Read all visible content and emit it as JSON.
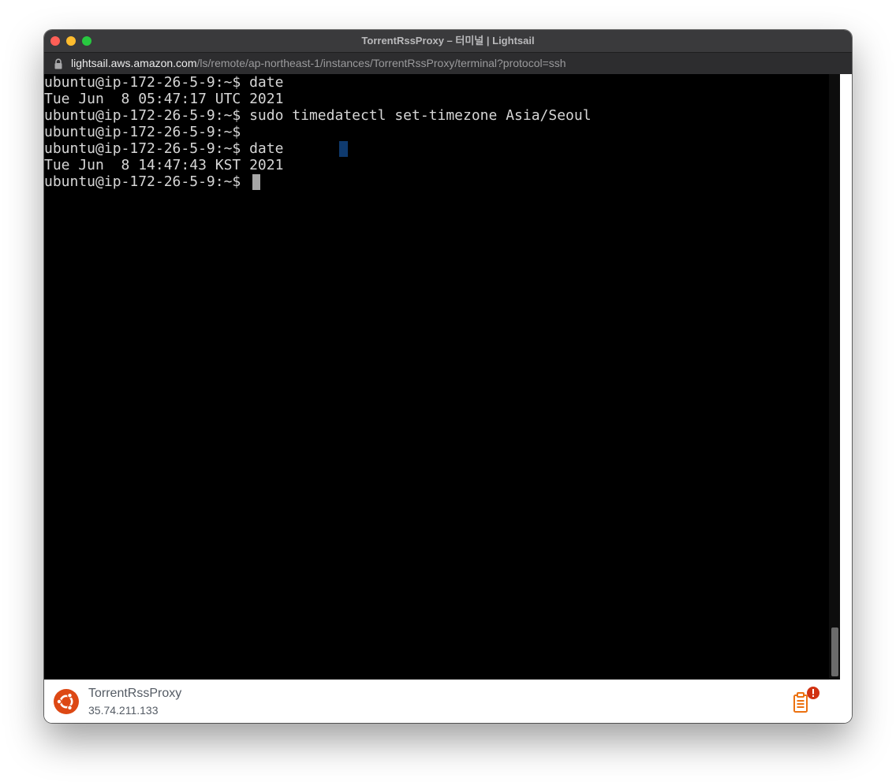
{
  "window": {
    "title": "TorrentRssProxy – 터미널 | Lightsail"
  },
  "address_bar": {
    "host": "lightsail.aws.amazon.com",
    "path": "/ls/remote/ap-northeast-1/instances/TorrentRssProxy/terminal?protocol=ssh"
  },
  "terminal": {
    "lines": [
      "ubuntu@ip-172-26-5-9:~$ date",
      "Tue Jun  8 05:47:17 UTC 2021",
      "ubuntu@ip-172-26-5-9:~$ sudo timedatectl set-timezone Asia/Seoul",
      "ubuntu@ip-172-26-5-9:~$",
      "ubuntu@ip-172-26-5-9:~$ date",
      "Tue Jun  8 14:47:43 KST 2021",
      "ubuntu@ip-172-26-5-9:~$"
    ]
  },
  "footer": {
    "instance_name": "TorrentRssProxy",
    "instance_ip": "35.74.211.133",
    "os_icon": "ubuntu-logo-icon",
    "log_icon": "clipboard-alert-icon"
  },
  "colors": {
    "terminal_bg": "#000000",
    "terminal_fg": "#d6d6d6",
    "titlebar_bg": "#3a3a3c",
    "ubuntu_orange": "#dd4814",
    "aws_orange": "#ec7211",
    "alert_red": "#d13212"
  }
}
